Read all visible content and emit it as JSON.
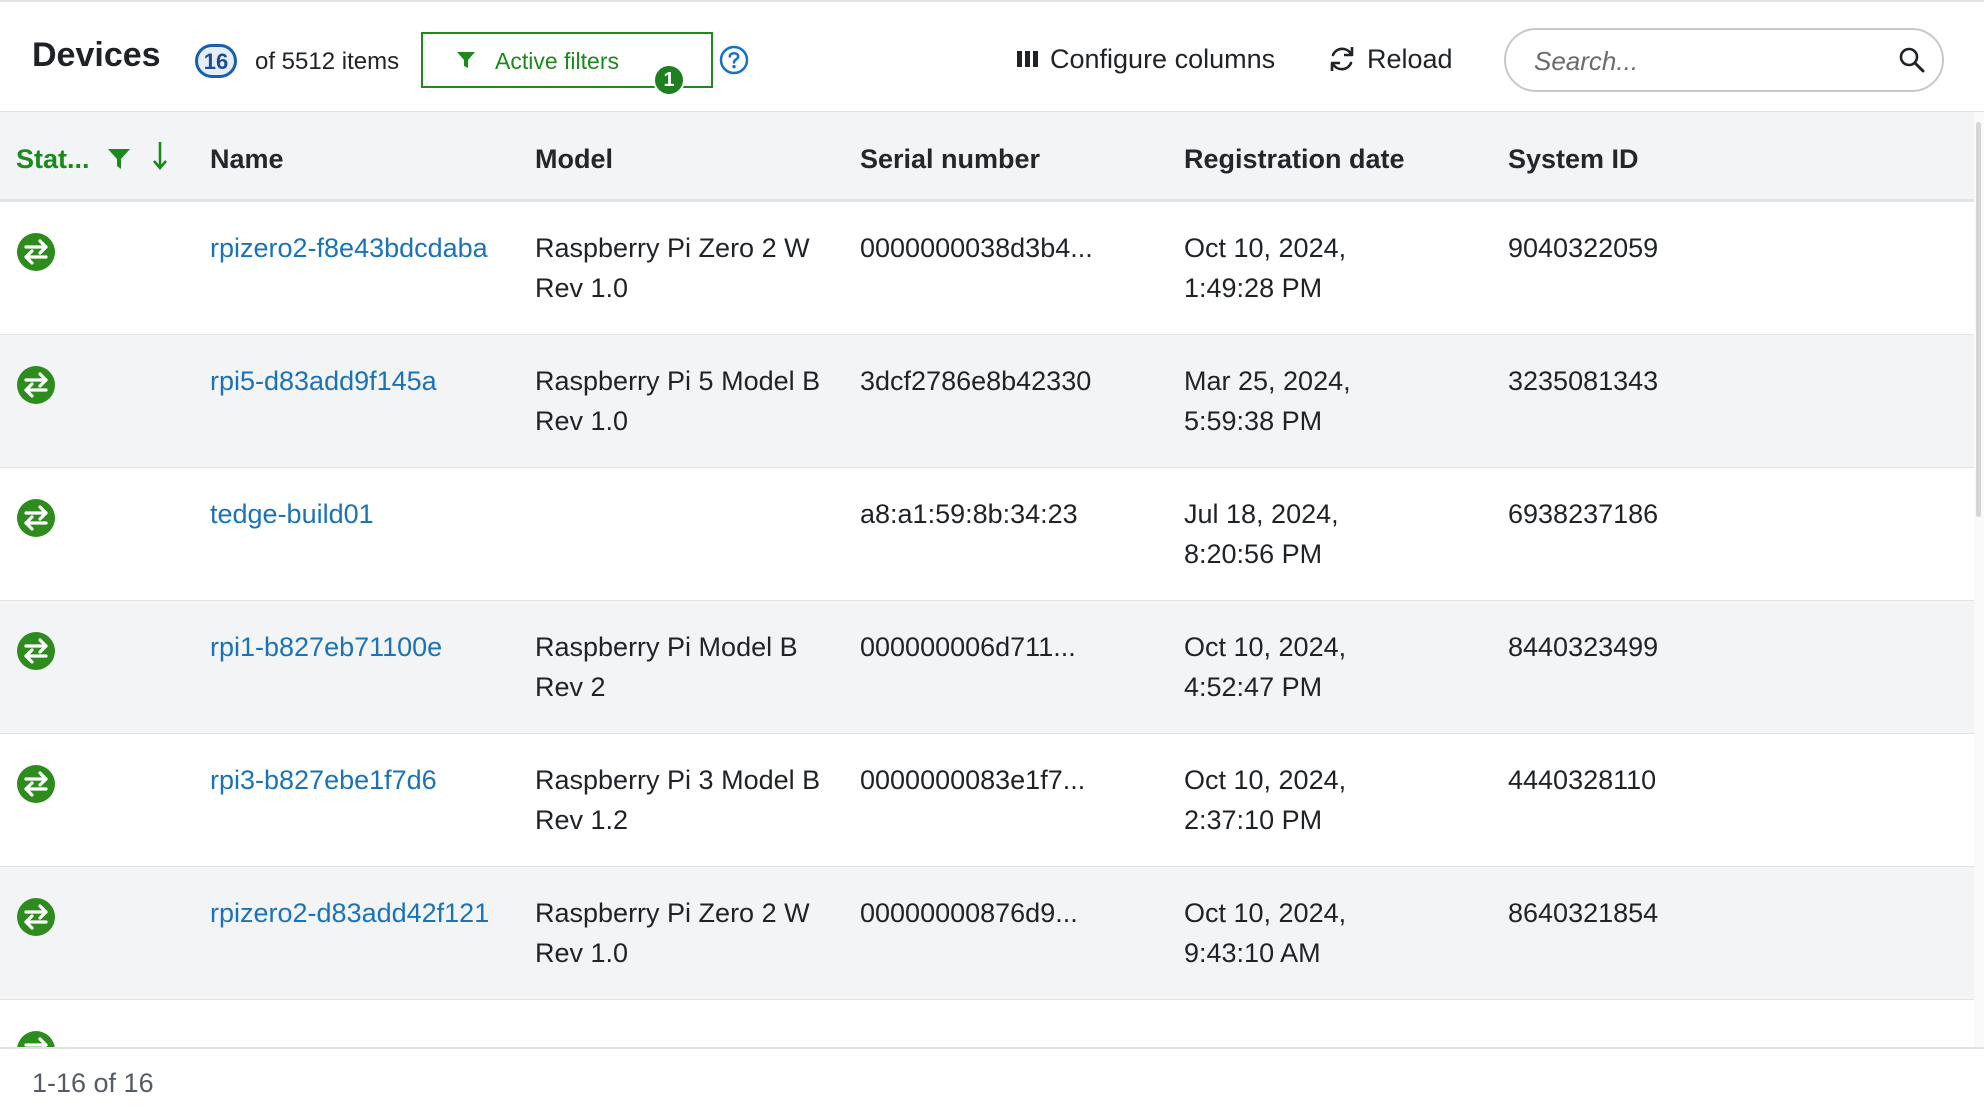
{
  "header": {
    "title": "Devices",
    "count_badge": "16",
    "count_text": "of 5512 items",
    "active_filters_label": "Active filters",
    "active_filters_count": "1",
    "configure_columns_label": "Configure columns",
    "reload_label": "Reload",
    "search_placeholder": "Search..."
  },
  "columns": [
    "Stat...",
    "Name",
    "Model",
    "Serial number",
    "Registration date",
    "System ID"
  ],
  "rows": [
    {
      "name": "rpizero2-f8e43bdcdaba",
      "model": "Raspberry Pi Zero 2 W Rev 1.0",
      "serial": "0000000038d3b4...",
      "date": "Oct 10, 2024, 1:49:28 PM",
      "system_id": "9040322059"
    },
    {
      "name": "rpi5-d83add9f145a",
      "model": "Raspberry Pi 5 Model B Rev 1.0",
      "serial": "3dcf2786e8b42330",
      "date": "Mar 25, 2024, 5:59:38 PM",
      "system_id": "3235081343"
    },
    {
      "name": "tedge-build01",
      "model": "",
      "serial": "a8:a1:59:8b:34:23",
      "date": "Jul 18, 2024, 8:20:56 PM",
      "system_id": "6938237186"
    },
    {
      "name": "rpi1-b827eb71100e",
      "model": "Raspberry Pi Model B Rev 2",
      "serial": "000000006d711...",
      "date": "Oct 10, 2024, 4:52:47 PM",
      "system_id": "8440323499"
    },
    {
      "name": "rpi3-b827ebe1f7d6",
      "model": "Raspberry Pi 3 Model B Rev 1.2",
      "serial": "0000000083e1f7...",
      "date": "Oct 10, 2024, 2:37:10 PM",
      "system_id": "4440328110"
    },
    {
      "name": "rpizero2-d83add42f121",
      "model": "Raspberry Pi Zero 2 W Rev 1.0",
      "serial": "00000000876d9...",
      "date": "Oct 10, 2024, 9:43:10 AM",
      "system_id": "8640321854"
    }
  ],
  "status_icon": "connection-arrows-icon",
  "status_color": "#2e8b1e",
  "footer": {
    "pagination": "1-16 of 16"
  }
}
